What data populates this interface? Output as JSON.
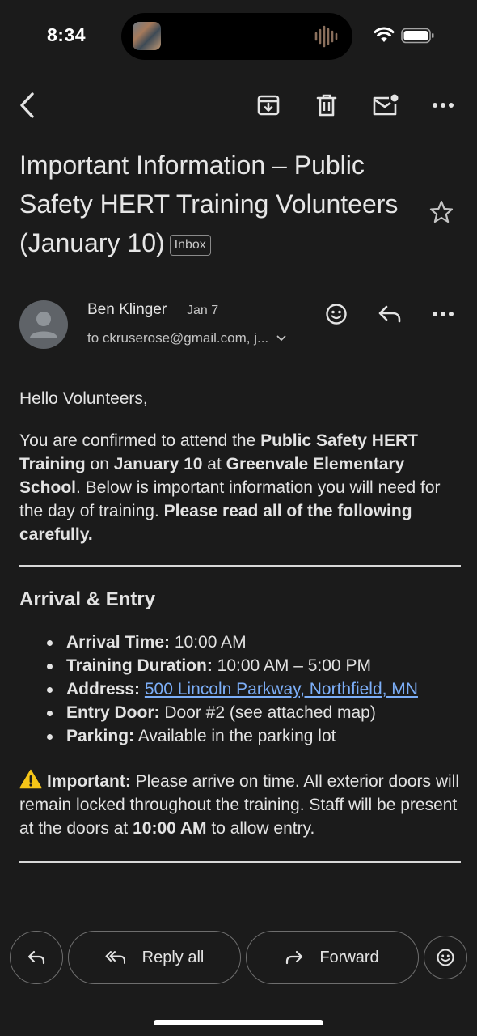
{
  "status": {
    "time": "8:34"
  },
  "email": {
    "subject": "Important Information – Public Safety HERT Training Volunteers (January 10)",
    "label": "Inbox",
    "sender": {
      "name": "Ben Klinger",
      "date": "Jan 7",
      "recipients": "to ckruserose@gmail.com, j..."
    },
    "greeting": "Hello Volunteers,",
    "intro": {
      "t1": "You are confirmed to attend the ",
      "b1": "Public Safety HERT Training",
      "t2": " on ",
      "b2": "January 10",
      "t3": " at ",
      "b3": "Greenvale Elementary School",
      "t4": ". Below is important information you will need for the day of training. ",
      "b4": "Please read all of the following carefully."
    },
    "section": {
      "title": "Arrival & Entry",
      "items": [
        {
          "label": "Arrival Time:",
          "value": " 10:00 AM"
        },
        {
          "label": "Training Duration:",
          "value": " 10:00 AM – 5:00 PM"
        },
        {
          "label": "Address:",
          "value": " ",
          "link": "500 Lincoln Parkway, Northfield, MN"
        },
        {
          "label": "Entry Door:",
          "value": " Door #2 (see attached map)"
        },
        {
          "label": "Parking:",
          "value": " Available in the parking lot"
        }
      ]
    },
    "important": {
      "label": "Important:",
      "t1": " Please arrive on time. All exterior doors will remain locked throughout the training. Staff will be present at the doors at ",
      "b1": "10:00 AM",
      "t2": " to allow entry."
    }
  },
  "actions": {
    "reply_all": "Reply all",
    "forward": "Forward"
  },
  "colors": {
    "background": "#1b1b1b",
    "link": "#7caef7",
    "avatar": "#5f6368",
    "warning": "#f5c518"
  }
}
